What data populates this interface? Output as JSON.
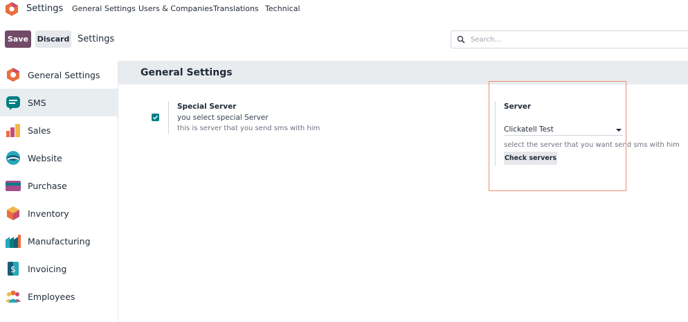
{
  "topnav": {
    "app_title": "Settings",
    "menu": [
      "General Settings",
      "Users & Companies",
      "Translations",
      "Technical"
    ]
  },
  "control": {
    "save_label": "Save",
    "discard_label": "Discard",
    "breadcrumb": "Settings",
    "search_placeholder": "Search..."
  },
  "sidebar": {
    "items": [
      {
        "label": "General Settings",
        "icon": "settings-app-icon"
      },
      {
        "label": "SMS",
        "icon": "sms-app-icon",
        "active": true
      },
      {
        "label": "Sales",
        "icon": "sales-app-icon"
      },
      {
        "label": "Website",
        "icon": "website-app-icon"
      },
      {
        "label": "Purchase",
        "icon": "purchase-app-icon"
      },
      {
        "label": "Inventory",
        "icon": "inventory-app-icon"
      },
      {
        "label": "Manufacturing",
        "icon": "manufacturing-app-icon"
      },
      {
        "label": "Invoicing",
        "icon": "invoicing-app-icon"
      },
      {
        "label": "Employees",
        "icon": "employees-app-icon"
      }
    ]
  },
  "main": {
    "section_title": "General Settings",
    "option": {
      "checked": true,
      "title": "Special Server",
      "line1": "you select special Server",
      "line2": "this is server that you send sms with him"
    },
    "server": {
      "label": "Server",
      "selected": "Clickatell Test",
      "help": "select the server that you want send sms with him",
      "check_button": "Check servers"
    }
  },
  "colors": {
    "brand": "#714b67",
    "accent": "#017e84",
    "highlight": "#f08a6c"
  }
}
